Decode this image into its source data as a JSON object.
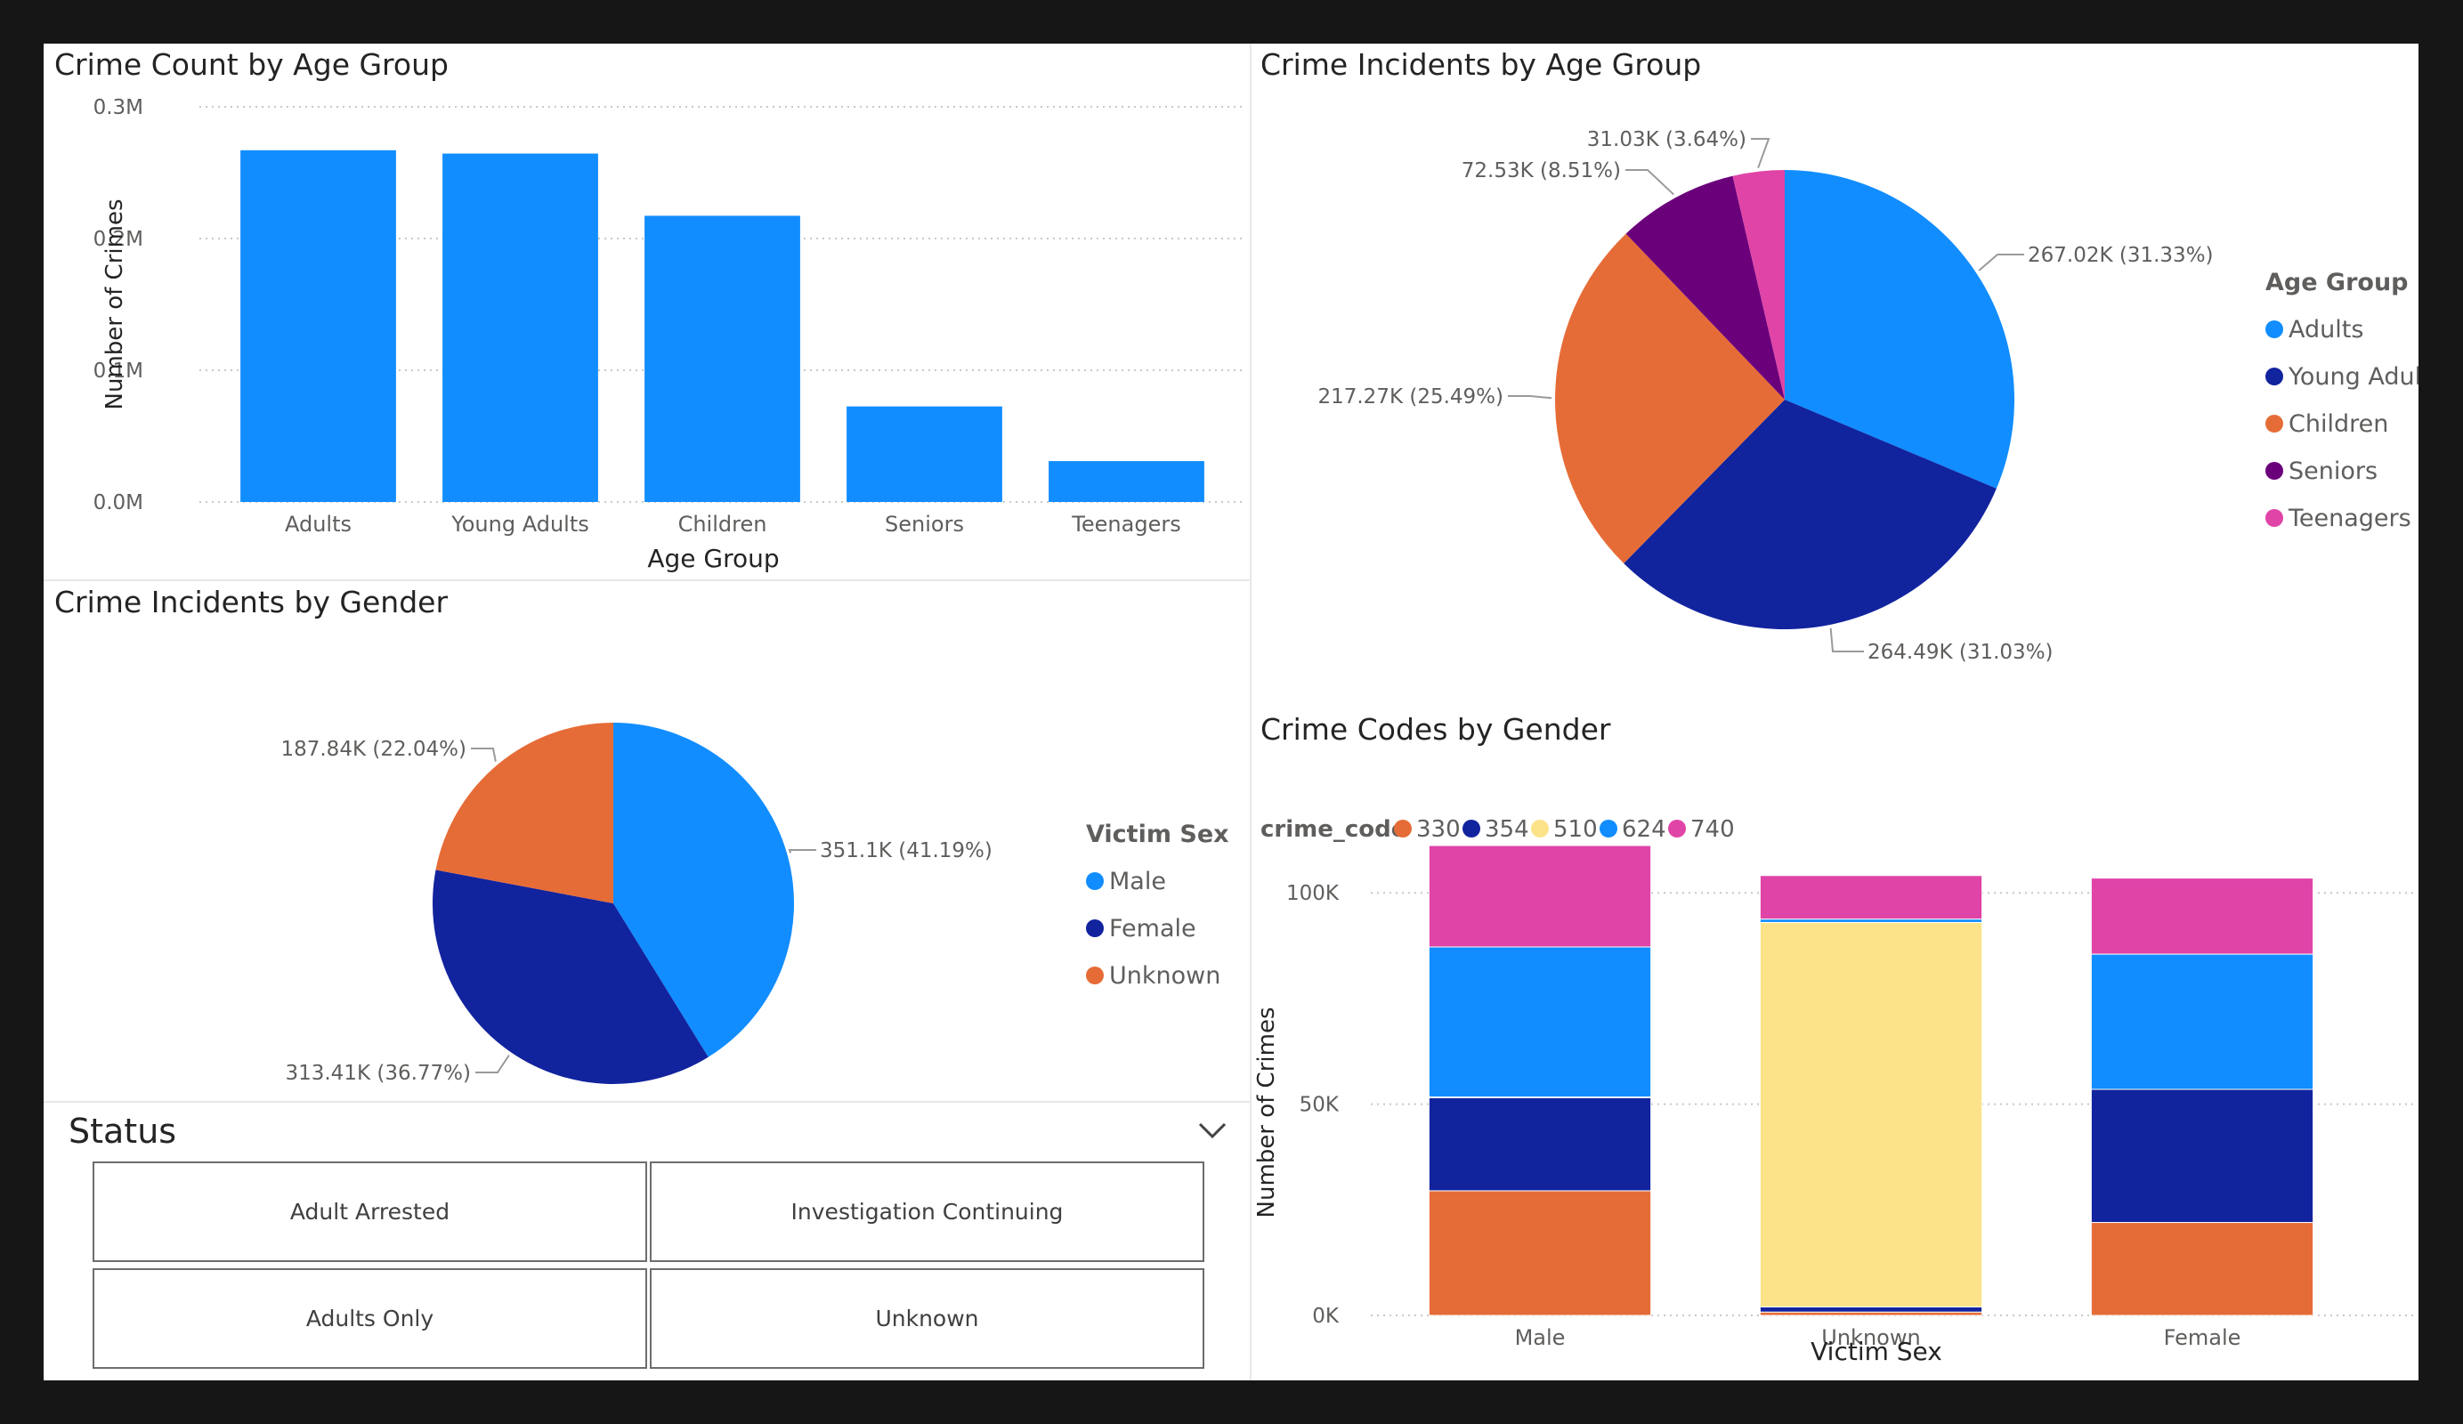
{
  "colors": {
    "blue": "#118DFF",
    "navy": "#12239E",
    "orange": "#E66C37",
    "purple": "#6B007B",
    "pink": "#E044A7",
    "yellow": "#FCE38A"
  },
  "panels": {
    "bar": {
      "title": "Crime Count by Age Group"
    },
    "age_pie": {
      "title": "Crime Incidents by Age Group"
    },
    "gender_pie": {
      "title": "Crime Incidents by Gender"
    },
    "stacked": {
      "title": "Crime Codes by Gender"
    }
  },
  "slicer": {
    "title": "Status",
    "options": [
      "Adult Arrested",
      "Investigation Continuing",
      "Adults Only",
      "Unknown"
    ]
  },
  "chart_data": [
    {
      "type": "bar",
      "title": "Crime Count by Age Group",
      "xlabel": "Age Group",
      "ylabel": "Number of Crimes",
      "categories": [
        "Adults",
        "Young Adults",
        "Children",
        "Seniors",
        "Teenagers"
      ],
      "values": [
        267020,
        264490,
        217270,
        72530,
        31030
      ],
      "ylim": [
        0,
        300000
      ],
      "yticks": [
        "0.0M",
        "0.1M",
        "0.2M",
        "0.3M"
      ],
      "ytick_values": [
        0,
        100000,
        200000,
        300000
      ],
      "grid": true
    },
    {
      "type": "pie",
      "title": "Crime Incidents by Age Group",
      "legend_title": "Age Group",
      "legend_position": "right",
      "slices": [
        {
          "name": "Adults",
          "value": 267020,
          "label": "267.02K (31.33%)",
          "color": "#118DFF"
        },
        {
          "name": "Young Adults",
          "value": 264490,
          "label": "264.49K (31.03%)",
          "color": "#12239E"
        },
        {
          "name": "Children",
          "value": 217270,
          "label": "217.27K (25.49%)",
          "color": "#E66C37"
        },
        {
          "name": "Seniors",
          "value": 72530,
          "label": "72.53K (8.51%)",
          "color": "#6B007B"
        },
        {
          "name": "Teenagers",
          "value": 31030,
          "label": "31.03K (3.64%)",
          "color": "#E044A7"
        }
      ]
    },
    {
      "type": "pie",
      "title": "Crime Incidents by Gender",
      "legend_title": "Victim Sex",
      "legend_position": "right",
      "slices": [
        {
          "name": "Male",
          "value": 351100,
          "label": "351.1K (41.19%)",
          "color": "#118DFF"
        },
        {
          "name": "Female",
          "value": 313410,
          "label": "313.41K (36.77%)",
          "color": "#12239E"
        },
        {
          "name": "Unknown",
          "value": 187840,
          "label": "187.84K (22.04%)",
          "color": "#E66C37"
        }
      ]
    },
    {
      "type": "bar",
      "stacked": true,
      "title": "Crime Codes by Gender",
      "xlabel": "Victim Sex",
      "ylabel": "Number of Crimes",
      "legend_title": "crime_code",
      "legend_position": "top-left",
      "categories": [
        "Male",
        "Unknown",
        "Female"
      ],
      "series": [
        {
          "name": "330",
          "color": "#E66C37",
          "values": [
            29500,
            800,
            22000
          ]
        },
        {
          "name": "354",
          "color": "#12239E",
          "values": [
            22000,
            1200,
            31500
          ]
        },
        {
          "name": "510",
          "color": "#FCE38A",
          "values": [
            200,
            91000,
            0
          ]
        },
        {
          "name": "624",
          "color": "#118DFF",
          "values": [
            35500,
            800,
            32000
          ]
        },
        {
          "name": "740",
          "color": "#E044A7",
          "values": [
            24000,
            10300,
            18000
          ]
        }
      ],
      "ylim": [
        0,
        115000
      ],
      "yticks": [
        "0K",
        "50K",
        "100K"
      ],
      "ytick_values": [
        0,
        50000,
        100000
      ],
      "grid": true
    }
  ]
}
